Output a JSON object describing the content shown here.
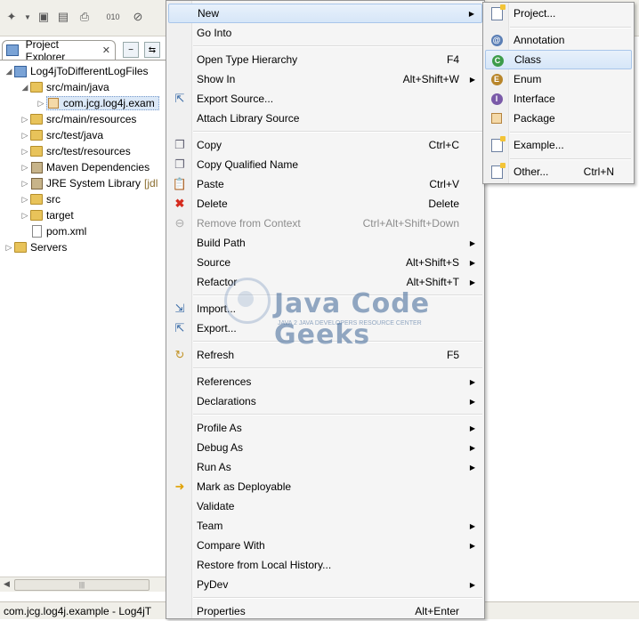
{
  "view": {
    "tab_label": "Project Explorer",
    "close": "✕"
  },
  "tree": [
    {
      "label": "Log4jToDifferentLogFiles",
      "icon": "project-icon",
      "twisty": "◢"
    },
    {
      "label": "src/main/java",
      "icon": "source-folder-icon",
      "twisty": "◢"
    },
    {
      "label": "com.jcg.log4j.exam",
      "icon": "package-icon",
      "twisty": "▷"
    },
    {
      "label": "src/main/resources",
      "icon": "source-folder-icon",
      "twisty": "▷"
    },
    {
      "label": "src/test/java",
      "icon": "source-folder-icon",
      "twisty": "▷"
    },
    {
      "label": "src/test/resources",
      "icon": "source-folder-icon",
      "twisty": "▷"
    },
    {
      "label": "Maven Dependencies",
      "icon": "library-icon",
      "twisty": "▷"
    },
    {
      "label": "JRE System Library",
      "suffix": "[jdl",
      "icon": "library-icon",
      "twisty": "▷"
    },
    {
      "label": "src",
      "icon": "folder-icon",
      "twisty": "▷"
    },
    {
      "label": "target",
      "icon": "folder-icon",
      "twisty": "▷"
    },
    {
      "label": "pom.xml",
      "icon": "xml-file-icon",
      "twisty": ""
    },
    {
      "label": "Servers",
      "icon": "folder-icon",
      "twisty": "▷"
    }
  ],
  "status": {
    "text": "com.jcg.log4j.example - Log4jT"
  },
  "menu": {
    "new": {
      "label": "New"
    },
    "go_into": {
      "label": "Go Into"
    },
    "open_type_hierarchy": {
      "label": "Open Type Hierarchy",
      "key": "F4"
    },
    "show_in": {
      "label": "Show In",
      "key": "Alt+Shift+W"
    },
    "export_source": {
      "label": "Export Source..."
    },
    "attach_library_source": {
      "label": "Attach Library Source"
    },
    "copy": {
      "label": "Copy",
      "key": "Ctrl+C"
    },
    "copy_qualified_name": {
      "label": "Copy Qualified Name"
    },
    "paste": {
      "label": "Paste",
      "key": "Ctrl+V"
    },
    "delete": {
      "label": "Delete",
      "key": "Delete"
    },
    "remove_from_context": {
      "label": "Remove from Context",
      "key": "Ctrl+Alt+Shift+Down"
    },
    "build_path": {
      "label": "Build Path"
    },
    "source": {
      "label": "Source",
      "key": "Alt+Shift+S"
    },
    "refactor": {
      "label": "Refactor",
      "key": "Alt+Shift+T"
    },
    "import": {
      "label": "Import..."
    },
    "export": {
      "label": "Export..."
    },
    "refresh": {
      "label": "Refresh",
      "key": "F5"
    },
    "references": {
      "label": "References"
    },
    "declarations": {
      "label": "Declarations"
    },
    "profile_as": {
      "label": "Profile As"
    },
    "debug_as": {
      "label": "Debug As"
    },
    "run_as": {
      "label": "Run As"
    },
    "mark_as_deployable": {
      "label": "Mark as Deployable"
    },
    "validate": {
      "label": "Validate"
    },
    "team": {
      "label": "Team"
    },
    "compare_with": {
      "label": "Compare With"
    },
    "restore_from_local_history": {
      "label": "Restore from Local History..."
    },
    "pydev": {
      "label": "PyDev"
    },
    "properties": {
      "label": "Properties",
      "key": "Alt+Enter"
    }
  },
  "submenu": {
    "project": {
      "label": "Project..."
    },
    "annotation": {
      "label": "Annotation"
    },
    "class": {
      "label": "Class"
    },
    "enum": {
      "label": "Enum"
    },
    "interface": {
      "label": "Interface"
    },
    "package": {
      "label": "Package"
    },
    "example": {
      "label": "Example..."
    },
    "other": {
      "label": "Other...",
      "key": "Ctrl+N"
    }
  },
  "watermark": {
    "title": "Java Code Geeks",
    "subtitle": "JAVA 2 JAVA DEVELOPERS RESOURCE CENTER"
  },
  "colors": {
    "highlight": "#d6e6f8",
    "annotation": "#5b7fb5",
    "class": "#3d9c4a",
    "enum": "#b8862b",
    "interface": "#7a5aa8"
  }
}
